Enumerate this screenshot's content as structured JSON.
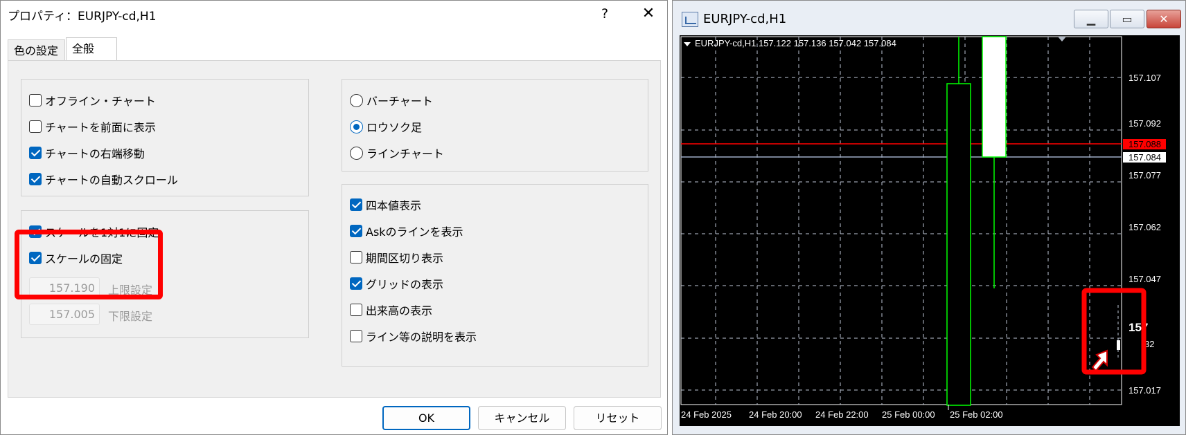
{
  "dialog": {
    "title": "プロパティ：EURJPY-cd,H1",
    "help": "?",
    "close": "✕",
    "tabs": [
      "色の設定",
      "全般"
    ],
    "left_options": [
      {
        "label": "オフライン・チャート",
        "checked": false
      },
      {
        "label": "チャートを前面に表示",
        "checked": false
      },
      {
        "label": "チャートの右端移動",
        "checked": true
      },
      {
        "label": "チャートの自動スクロール",
        "checked": true
      }
    ],
    "scale_options": [
      {
        "label": "スケールを1対1に固定",
        "checked": true
      },
      {
        "label": "スケールの固定",
        "checked": true
      }
    ],
    "upper_limit": {
      "value": "157.190",
      "label": "上限設定"
    },
    "lower_limit": {
      "value": "157.005",
      "label": "下限設定"
    },
    "chart_types": [
      {
        "label": "バーチャート",
        "selected": false
      },
      {
        "label": "ロウソク足",
        "selected": true
      },
      {
        "label": "ラインチャート",
        "selected": false
      }
    ],
    "display_options": [
      {
        "label": "四本値表示",
        "checked": true
      },
      {
        "label": "Askのラインを表示",
        "checked": true
      },
      {
        "label": "期間区切り表示",
        "checked": false
      },
      {
        "label": "グリッドの表示",
        "checked": true
      },
      {
        "label": "出来高の表示",
        "checked": false
      },
      {
        "label": "ライン等の説明を表示",
        "checked": false
      }
    ],
    "buttons": {
      "ok": "OK",
      "cancel": "キャンセル",
      "reset": "リセット"
    }
  },
  "chart_window": {
    "title": "EURJPY-cd,H1",
    "info_line": "EURJPY-cd,H1  157.122 157.136 157.042 157.084",
    "price_labels": [
      "157.107",
      "157.092",
      "157.077",
      "157.062",
      "157.047",
      "157.017"
    ],
    "ask_price": "157.088",
    "bid_price": "157.084",
    "partial_label_big": "157",
    "partial_label_small": "32",
    "time_labels": [
      "24 Feb 2025",
      "24 Feb 20:00",
      "24 Feb 22:00",
      "25 Feb 00:00",
      "25 Feb 02:00"
    ],
    "colors": {
      "background": "#000000",
      "grid": "#c0c8d8",
      "bull": "#00ff00",
      "ask_line": "#ff0000",
      "bid_line": "#a0aec8",
      "highlight": "#ff0000"
    }
  }
}
